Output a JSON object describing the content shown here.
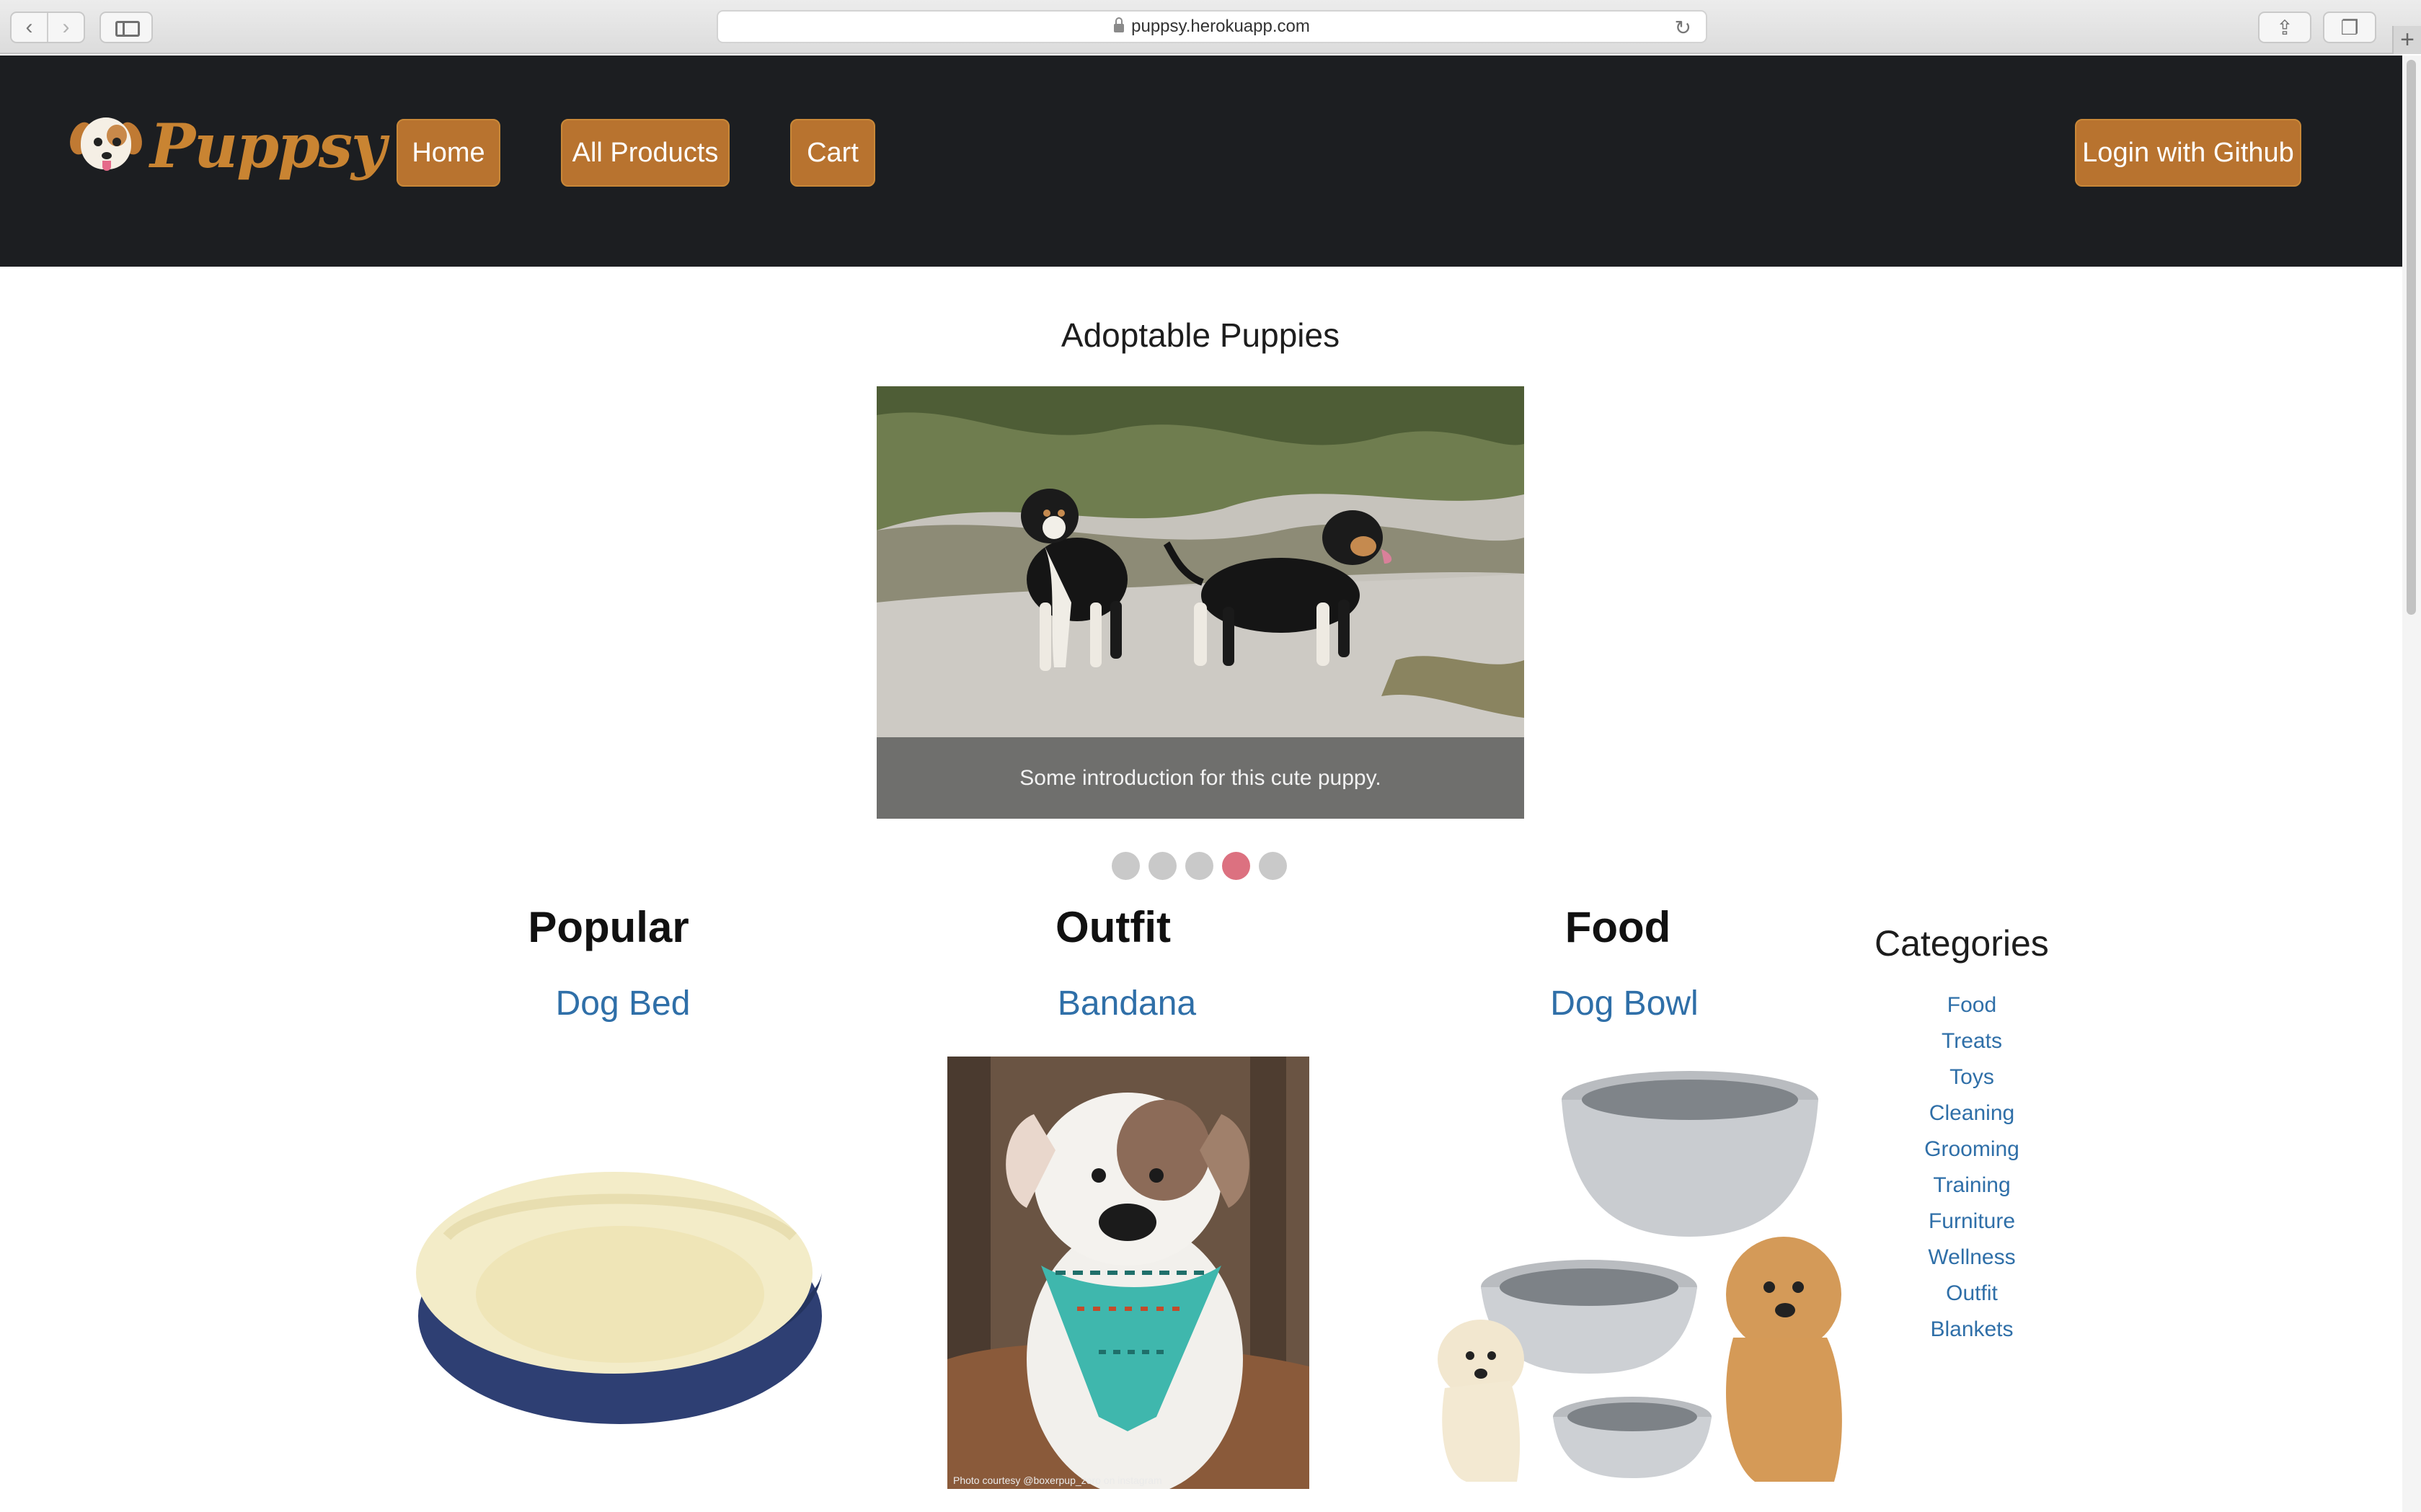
{
  "browser": {
    "url": "puppsy.herokuapp.com",
    "back_glyph": "‹",
    "forward_glyph": "›",
    "reload_glyph": "↻",
    "share_glyph": "⇪",
    "tabs_glyph": "❐",
    "newtab_glyph": "+"
  },
  "navbar": {
    "brand": "Puppsy",
    "home": "Home",
    "all_products": "All Products",
    "cart": "Cart",
    "login": "Login with Github"
  },
  "carousel": {
    "title": "Adoptable Puppies",
    "caption": "Some introduction for this cute puppy.",
    "slide_count": 5,
    "active_slide": 4
  },
  "columns": [
    {
      "heading": "Popular",
      "product": "Dog Bed"
    },
    {
      "heading": "Outfit",
      "product": "Bandana",
      "photo_credit": "Photo courtesy @boxerpup_zero on instagram"
    },
    {
      "heading": "Food",
      "product": "Dog Bowl"
    }
  ],
  "categories": {
    "title": "Categories",
    "items": [
      "Food",
      "Treats",
      "Toys",
      "Cleaning",
      "Grooming",
      "Training",
      "Furniture",
      "Wellness",
      "Outfit",
      "Blankets"
    ]
  },
  "colors": {
    "navbar_bg": "#1c1e21",
    "accent": "#b8732f",
    "link": "#2f6fa8",
    "active_dot": "#dc7180"
  }
}
